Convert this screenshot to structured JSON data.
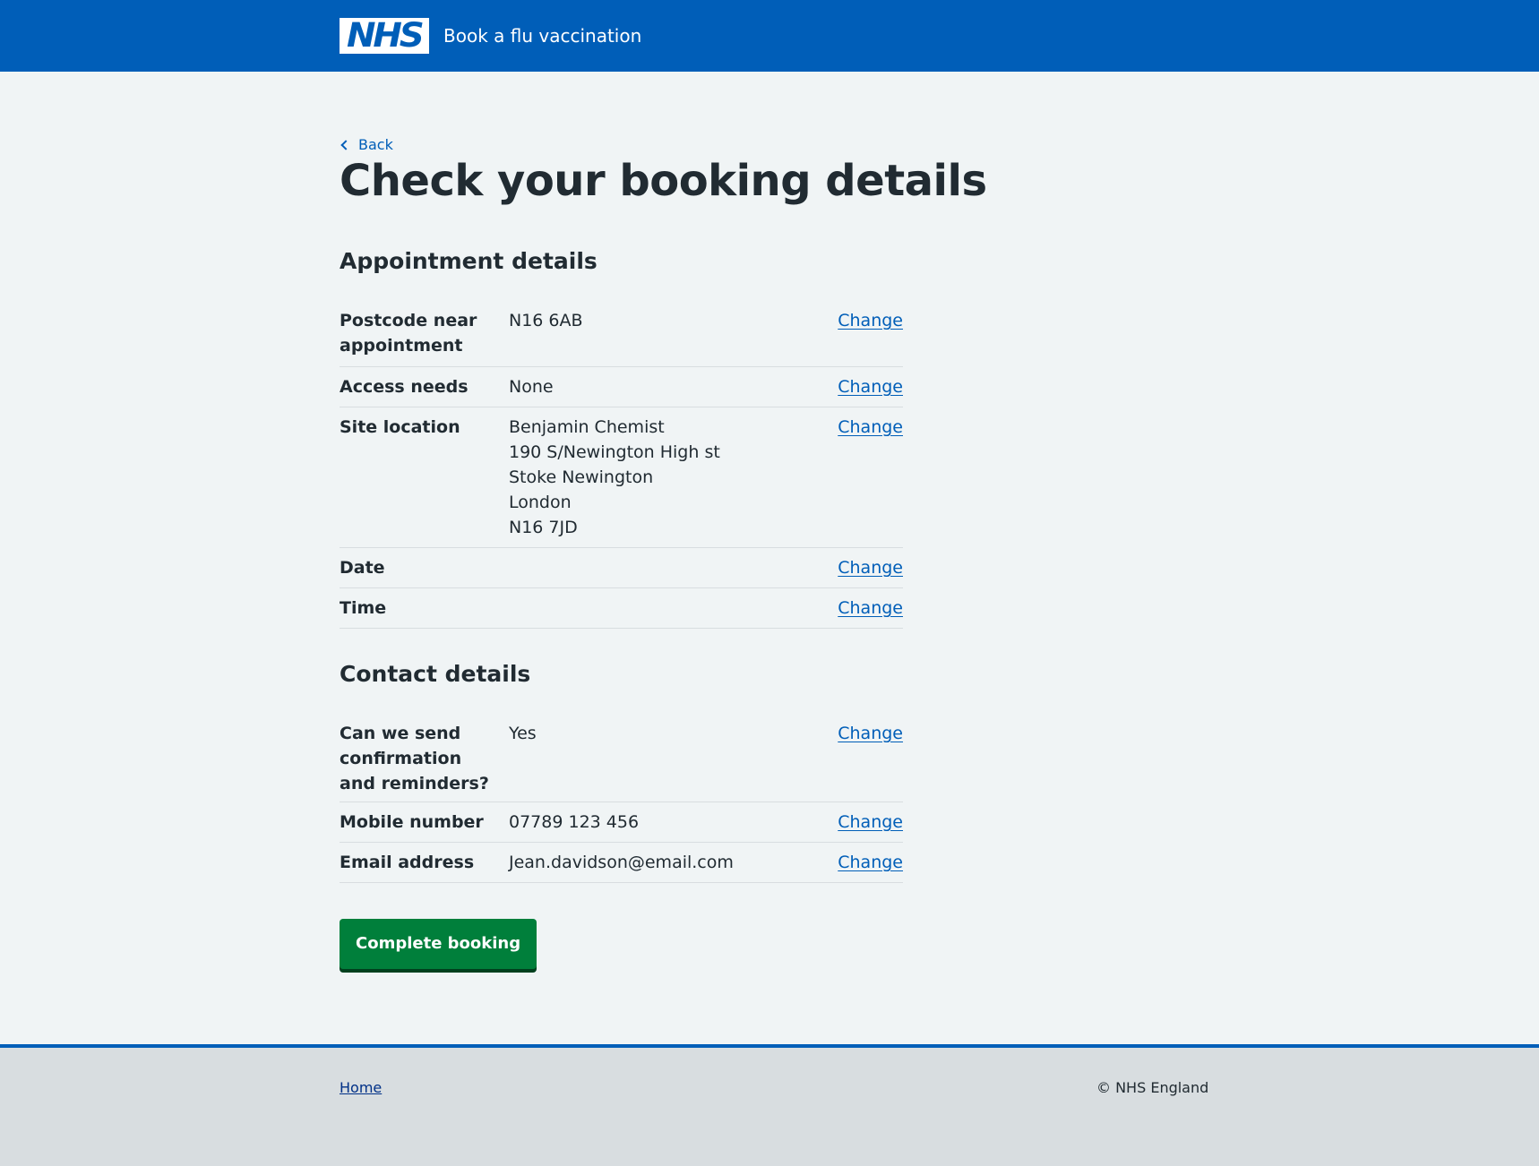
{
  "header": {
    "logo_text": "NHS",
    "service_name": "Book a flu vaccination"
  },
  "main": {
    "back_label": "Back",
    "title": "Check your booking details",
    "appointment": {
      "heading": "Appointment details",
      "rows": [
        {
          "key": "Postcode near appointment",
          "value": [
            "N16 6AB"
          ],
          "action": "Change"
        },
        {
          "key": "Access needs",
          "value": [
            "None"
          ],
          "action": "Change"
        },
        {
          "key": "Site location",
          "value": [
            "Benjamin Chemist",
            "190 S/Newington High st",
            "Stoke Newington",
            "London",
            "N16 7JD"
          ],
          "action": "Change"
        },
        {
          "key": "Date",
          "value": [],
          "action": "Change"
        },
        {
          "key": "Time",
          "value": [],
          "action": "Change"
        }
      ]
    },
    "contact": {
      "heading": "Contact details",
      "rows": [
        {
          "key": "Can we send confirmation and reminders?",
          "value": [
            "Yes"
          ],
          "action": "Change"
        },
        {
          "key": "Mobile number",
          "value": [
            "07789 123 456"
          ],
          "action": "Change"
        },
        {
          "key": "Email address",
          "value": [
            "Jean.davidson@email.com"
          ],
          "action": "Change"
        }
      ]
    },
    "submit_label": "Complete booking"
  },
  "footer": {
    "home_link": "Home",
    "copyright": "© NHS England"
  },
  "colors": {
    "nhs_blue": "#005eb8",
    "background": "#f0f4f5",
    "button_green": "#007f3b",
    "text": "#212b32",
    "footer_bg": "#d8dde0"
  }
}
